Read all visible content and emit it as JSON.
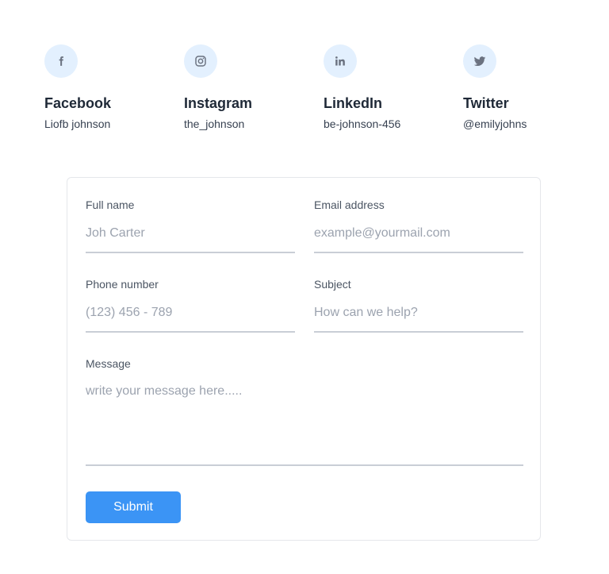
{
  "socials": [
    {
      "icon": "facebook-icon",
      "title": "Facebook",
      "handle": "Liofb johnson"
    },
    {
      "icon": "instagram-icon",
      "title": "Instagram",
      "handle": "the_johnson"
    },
    {
      "icon": "linkedin-icon",
      "title": "LinkedIn",
      "handle": "be-johnson-456"
    },
    {
      "icon": "twitter-icon",
      "title": "Twitter",
      "handle": "@emilyjohns"
    }
  ],
  "form": {
    "full_name": {
      "label": "Full name",
      "placeholder": "Joh Carter",
      "value": ""
    },
    "email": {
      "label": "Email address",
      "placeholder": "example@yourmail.com",
      "value": ""
    },
    "phone": {
      "label": "Phone number",
      "placeholder": "(123) 456 - 789",
      "value": ""
    },
    "subject": {
      "label": "Subject",
      "placeholder": "How can we help?",
      "value": ""
    },
    "message": {
      "label": "Message",
      "placeholder": "write your message here.....",
      "value": ""
    },
    "submit_label": "Submit"
  },
  "colors": {
    "accent": "#3b94f5",
    "icon_bg": "#e3f0fe",
    "underline": "#c9ced6"
  }
}
